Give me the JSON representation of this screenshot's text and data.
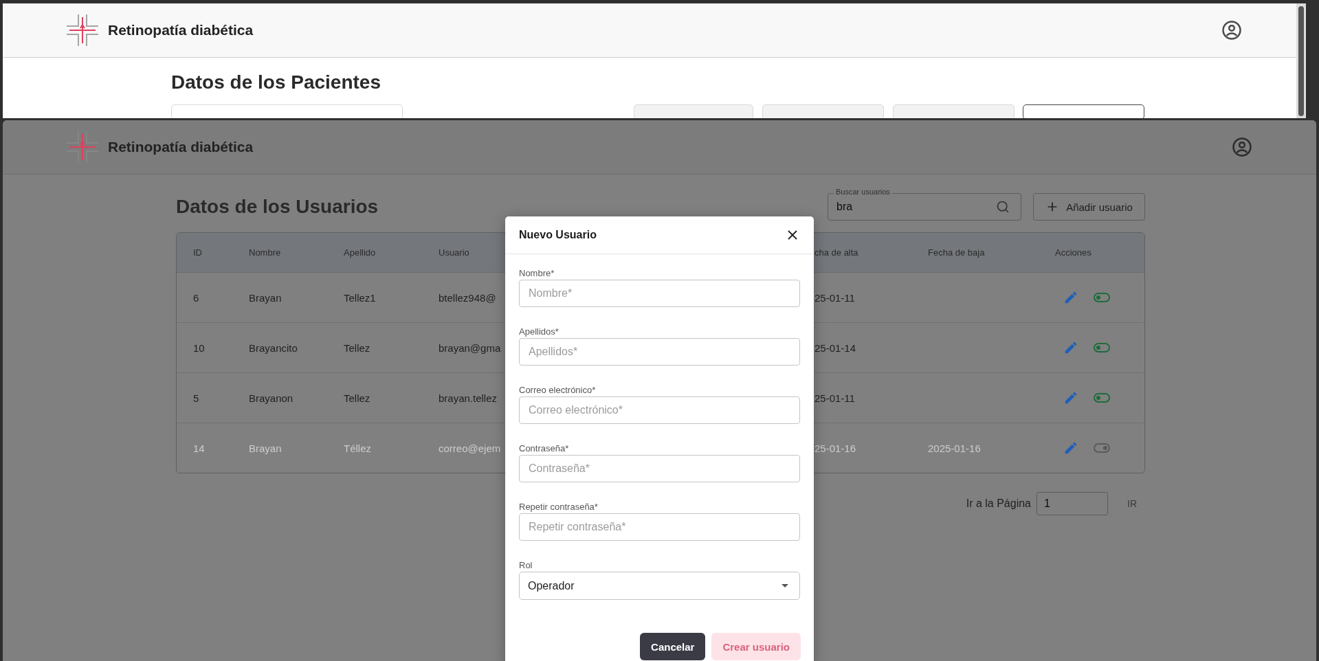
{
  "background_window": {
    "app_title": "Retinopatía diabética",
    "heading": "Datos de los Pacientes"
  },
  "window": {
    "app_title": "Retinopatía diabética",
    "heading": "Datos de los Usuarios",
    "search": {
      "label": "Buscar usuarios",
      "value": "bra"
    },
    "add_button": "Añadir usuario",
    "table": {
      "columns": [
        "ID",
        "Nombre",
        "Apellido",
        "Usuario",
        "cha de alta",
        "Fecha de baja",
        "Acciones"
      ],
      "rows": [
        {
          "id": "6",
          "nombre": "Brayan",
          "apellido": "Tellez1",
          "usuario": "btellez948@",
          "fecha_alta": "25-01-11",
          "active": true
        },
        {
          "id": "10",
          "nombre": "Brayancito",
          "apellido": "Tellez",
          "usuario": "brayan@gma",
          "fecha_alta": "25-01-14",
          "active": true
        },
        {
          "id": "5",
          "nombre": "Brayanon",
          "apellido": "Tellez",
          "usuario": "brayan.tellez",
          "fecha_alta": "25-01-11",
          "active": true
        },
        {
          "id": "14",
          "nombre": "Brayan",
          "apellido": "Téllez",
          "usuario": "correo@ejem",
          "fecha_alta": "25-01-16",
          "fecha_baja": "2025-01-16",
          "active": false
        }
      ]
    },
    "pagination": {
      "label": "Ir a la Página",
      "value": "1",
      "button": "IR"
    }
  },
  "dialog": {
    "title": "Nuevo Usuario",
    "fields": [
      {
        "kind": "text",
        "label": "Nombre*",
        "placeholder": "Nombre*"
      },
      {
        "kind": "text",
        "label": "Apellidos*",
        "placeholder": "Apellidos*"
      },
      {
        "kind": "text",
        "label": "Correo electrónico*",
        "placeholder": "Correo electrónico*"
      },
      {
        "kind": "text",
        "label": "Contraseña*",
        "placeholder": "Contraseña*"
      },
      {
        "kind": "text",
        "label": "Repetir contraseña*",
        "placeholder": "Repetir contraseña*"
      },
      {
        "kind": "select",
        "label": "Rol",
        "value": "Operador"
      }
    ],
    "buttons": [
      {
        "label": "Cancelar",
        "disabled": false
      },
      {
        "label": "Crear usuario",
        "disabled": true
      }
    ]
  }
}
